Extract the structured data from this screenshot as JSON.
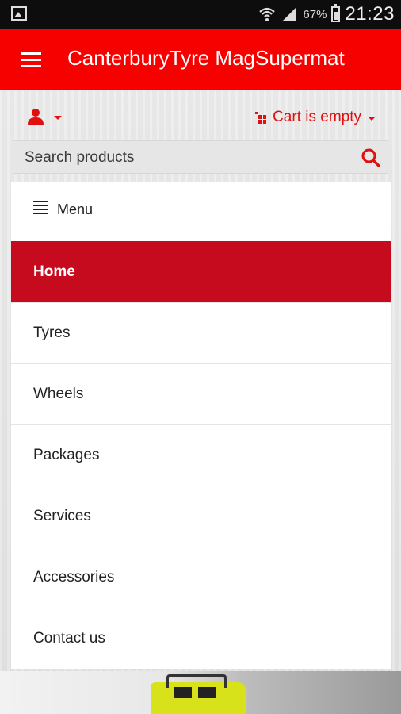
{
  "status_bar": {
    "battery_percent": "67%",
    "time": "21:23"
  },
  "app_bar": {
    "title": "CanterburyTyre MagSupermat"
  },
  "toolbar": {
    "cart_label": "Cart is empty"
  },
  "search": {
    "placeholder": "Search products"
  },
  "menu": {
    "header_label": "Menu",
    "items": [
      {
        "label": "Home",
        "active": true
      },
      {
        "label": "Tyres",
        "active": false
      },
      {
        "label": "Wheels",
        "active": false
      },
      {
        "label": "Packages",
        "active": false
      },
      {
        "label": "Services",
        "active": false
      },
      {
        "label": "Accessories",
        "active": false
      },
      {
        "label": "Contact us",
        "active": false
      }
    ]
  },
  "colors": {
    "app_bar": "#f70000",
    "accent_red": "#e01010",
    "active_item": "#c70b1e"
  },
  "icons": [
    "image-icon",
    "wifi-icon",
    "signal-icon",
    "battery-icon",
    "hamburger-icon",
    "user-icon",
    "cart-icon",
    "search-icon",
    "list-icon"
  ]
}
